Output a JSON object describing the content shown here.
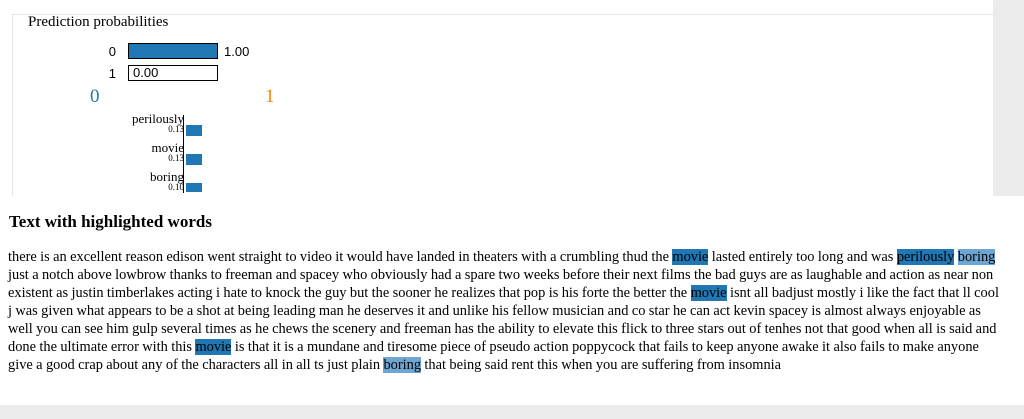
{
  "prediction": {
    "title": "Prediction probabilities",
    "rows": [
      {
        "class": "0",
        "value_text": "1.00",
        "value": 1.0
      },
      {
        "class": "1",
        "value_text": "0.00",
        "value": 0.0
      }
    ],
    "class_labels": [
      "0",
      "1"
    ],
    "colors": {
      "class0": "#1f77b4",
      "class1": "#ff7f0e"
    }
  },
  "features": [
    {
      "word": "perilously",
      "weight": "0.13"
    },
    {
      "word": "movie",
      "weight": "0.13"
    },
    {
      "word": "boring",
      "weight": "0.10"
    }
  ],
  "text_section": {
    "title": "Text with highlighted words",
    "segments": [
      {
        "text": "there is an excellent reason edison went straight to video it would have landed in theaters with a crumbling thud the ",
        "hl": ""
      },
      {
        "text": "movie",
        "hl": "dark"
      },
      {
        "text": " lasted entirely too long and was ",
        "hl": ""
      },
      {
        "text": "perilously",
        "hl": "dark"
      },
      {
        "text": " ",
        "hl": ""
      },
      {
        "text": "boring",
        "hl": "light"
      },
      {
        "text": " just a notch above lowbrow thanks to freeman and spacey who obviously had a spare two weeks before their next films the bad guys are as laughable and action as near non existent as justin timberlakes acting i hate to knock the guy but the sooner he realizes that pop is his forte the better the ",
        "hl": ""
      },
      {
        "text": "movie",
        "hl": "dark"
      },
      {
        "text": " isnt all badjust mostly i like the fact that ll cool j was given what appears to be a shot at being leading man he deserves it and unlike his fellow musician and co star he can act kevin spacey is almost always enjoyable as well you can see him gulp several times as he chews the scenery and freeman has the ability to elevate this flick to three stars out of tenhes not that good when all is said and done the ultimate error with this ",
        "hl": ""
      },
      {
        "text": "movie",
        "hl": "dark"
      },
      {
        "text": " is that it is a mundane and tiresome piece of pseudo action poppycock that fails to keep anyone awake it also fails to make anyone give a good crap about any of the characters all in all ts just plain ",
        "hl": ""
      },
      {
        "text": "boring",
        "hl": "light"
      },
      {
        "text": " that being said rent this when you are suffering from insomnia",
        "hl": ""
      }
    ]
  }
}
